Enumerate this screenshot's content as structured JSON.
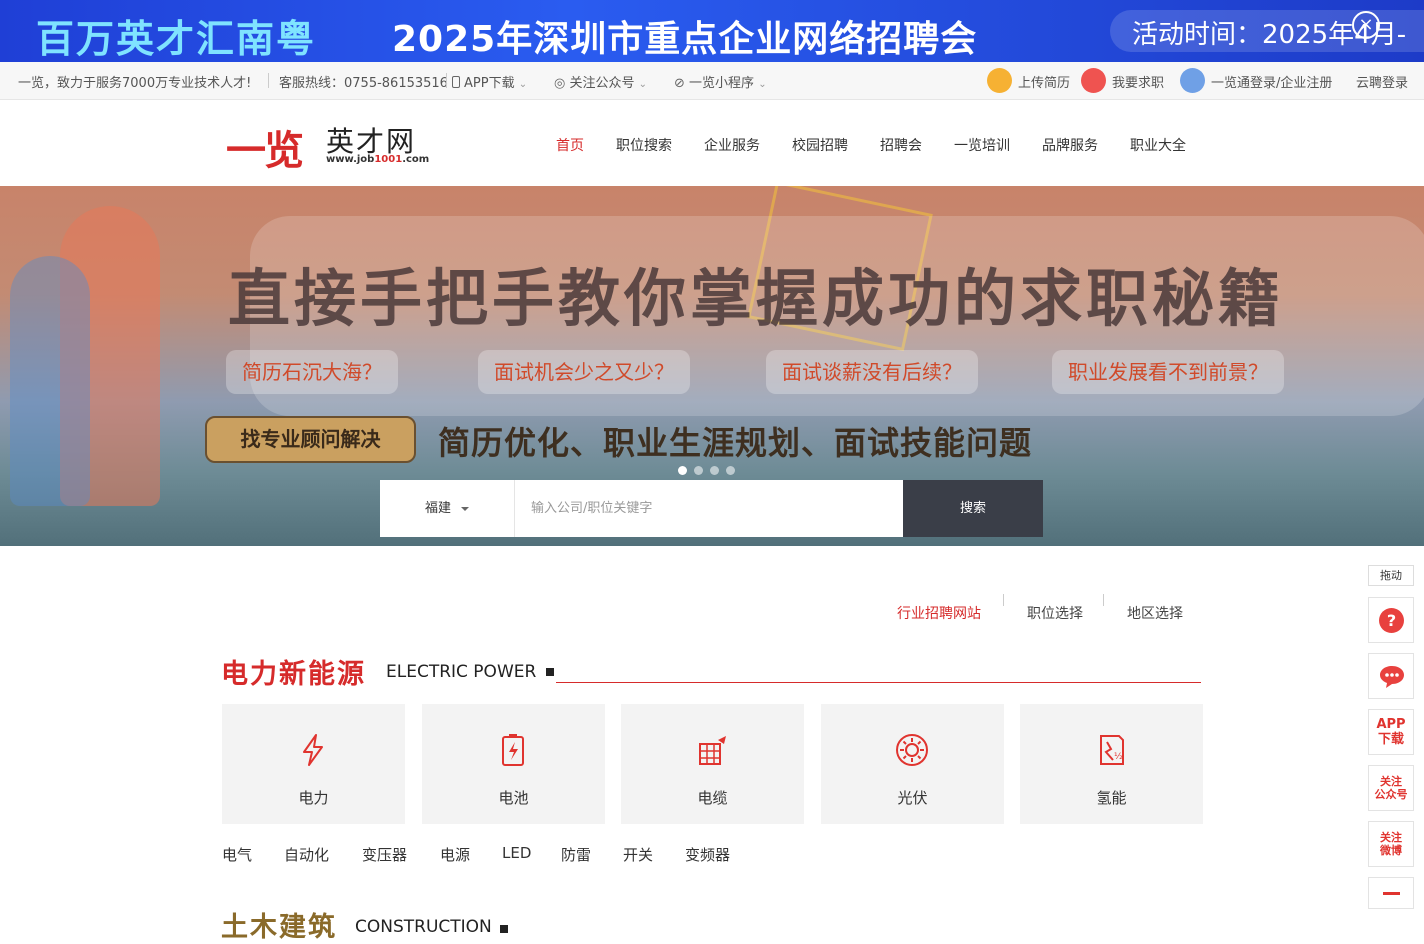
{
  "promo": {
    "left_text": "百万英才汇南粤",
    "main_text": "2025年深圳市重点企业网络招聘会",
    "right_text": "活动时间：2025年4月-",
    "close_icon": "close-icon"
  },
  "util": {
    "slogan": "一览，致力于服务7000万专业技术人才!",
    "hotline": "客服热线：0755-86153516",
    "app_download": "APP下载",
    "follow_wechat": "关注公众号",
    "mini_program": "一览小程序",
    "upload_resume": "上传简历",
    "job_seek": "我要求职",
    "login_register": "一览通登录/企业注册",
    "cloud_login": "云聘登录"
  },
  "header": {
    "logo_main": "一览",
    "logo_sub": "英才网",
    "logo_url_a": "www.job",
    "logo_url_b": "1001",
    "logo_url_c": ".com",
    "nav": [
      "首页",
      "职位搜索",
      "企业服务",
      "校园招聘",
      "招聘会",
      "一览培训",
      "品牌服务",
      "职业大全"
    ]
  },
  "hero": {
    "headline": "直接手把手教你掌握成功的求职秘籍",
    "pains": [
      "简历石沉大海？",
      "面试机会少之又少？",
      "面试谈薪没有后续？",
      "职业发展看不到前景？"
    ],
    "cta": "找专业顾问解决",
    "tagline": "简历优化、职业生涯规划、面试技能问题",
    "slide_count": 4,
    "active_slide": 1
  },
  "search": {
    "city": "福建",
    "placeholder": "输入公司/职位关键字",
    "button": "搜索"
  },
  "tabs": {
    "items": [
      "行业招聘网站",
      "职位选择",
      "地区选择"
    ],
    "active": 0
  },
  "section1": {
    "title": "电力新能源",
    "title_en": "ELECTRIC POWER",
    "cards": [
      {
        "label": "电力",
        "icon": "lightning-icon"
      },
      {
        "label": "电池",
        "icon": "battery-icon"
      },
      {
        "label": "电缆",
        "icon": "cable-icon"
      },
      {
        "label": "光伏",
        "icon": "solar-icon"
      },
      {
        "label": "氢能",
        "icon": "hydrogen-icon"
      }
    ],
    "subs": [
      "电气",
      "自动化",
      "变压器",
      "电源",
      "LED",
      "防雷",
      "开关",
      "变频器"
    ]
  },
  "section2": {
    "title": "土木建筑",
    "title_en": "CONSTRUCTION"
  },
  "float": {
    "drag": "拖动",
    "help": "?",
    "app_a": "APP",
    "app_b": "下载",
    "wechat_a": "关注",
    "wechat_b": "公众号",
    "weibo_a": "关注",
    "weibo_b": "微博"
  },
  "colors": {
    "brand_red": "#d62b2b",
    "dark_button": "#3a3e48",
    "promo_blue": "#2a5cf0"
  }
}
